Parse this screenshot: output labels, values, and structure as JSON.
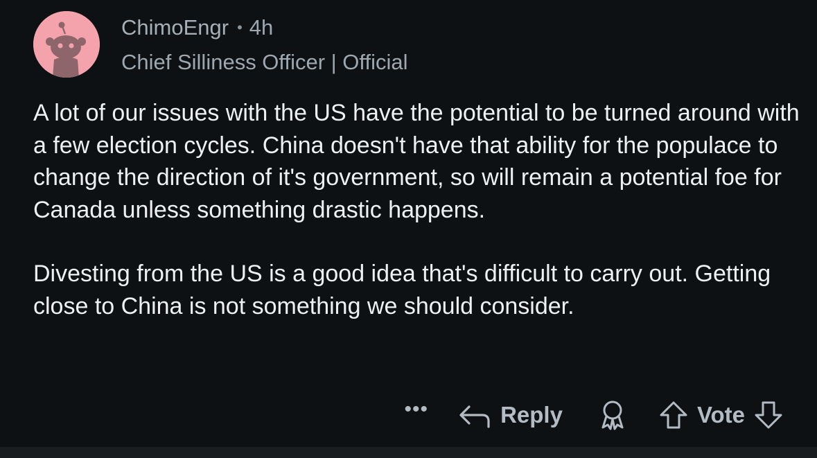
{
  "comment": {
    "author": "ChimoEngr",
    "separator": "•",
    "time_ago": "4h",
    "flair": "Chief Silliness Officer | Official",
    "paragraphs": [
      "A lot of our issues with the US have the potential to be turned around with a few election cycles. China doesn't have that  ability for the populace to change the direction of it's government, so will remain a potential foe for Canada unless something drastic happens.",
      "Divesting from the US is a good idea that's difficult to carry out. Getting close to China is not something we should consider."
    ]
  },
  "actions": {
    "more_label": "•••",
    "reply_label": "Reply",
    "vote_label": "Vote"
  },
  "icons": {
    "avatar": "snoo-avatar",
    "reply": "reply-arrow-icon",
    "award": "award-icon",
    "upvote": "upvote-icon",
    "downvote": "downvote-icon"
  },
  "colors": {
    "background": "#0e1113",
    "avatar_bg": "#f4a3ad",
    "text": "#eef1f3",
    "muted": "#9ea8b1",
    "action": "#b3bcc4"
  }
}
